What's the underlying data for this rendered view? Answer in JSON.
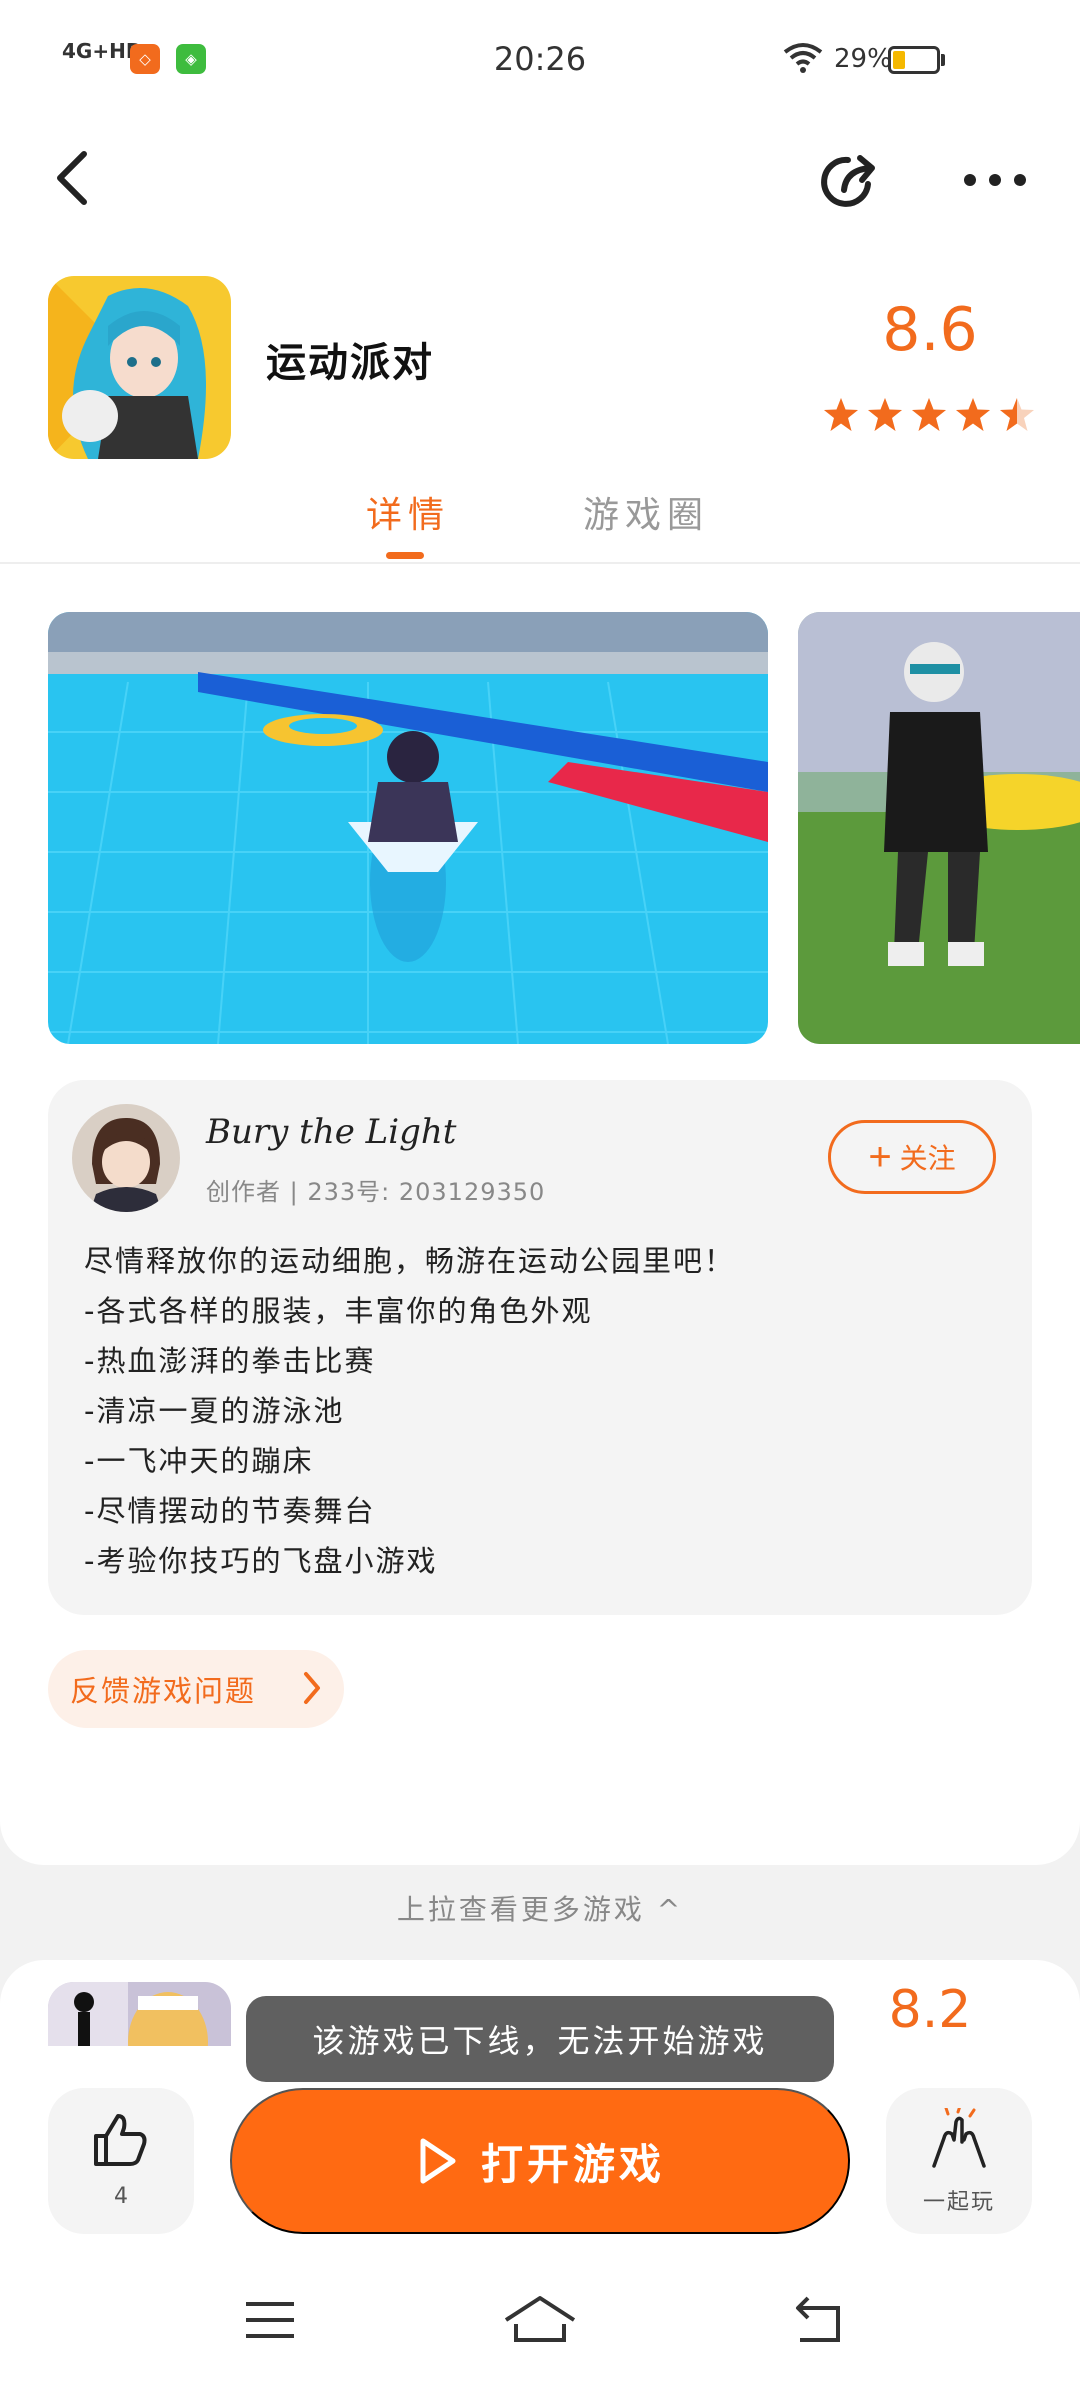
{
  "status_bar": {
    "network": "4G+HD",
    "time": "20:26",
    "battery_text": "29%",
    "battery_level": 0.29,
    "app_icons": [
      {
        "name": "app-icon-orange",
        "color": "#f26b1d"
      },
      {
        "name": "app-icon-green",
        "color": "#3ebc3e"
      }
    ]
  },
  "app": {
    "title": "运动派对",
    "rating": "8.6",
    "stars": 4.5
  },
  "tabs": [
    {
      "label": "详情",
      "active": true
    },
    {
      "label": "游戏圈",
      "active": false
    }
  ],
  "creator": {
    "name": "Bury the Light",
    "meta": "创作者 | 233号: 203129350",
    "follow_label": "关注"
  },
  "description": [
    "尽情释放你的运动细胞，畅游在运动公园里吧！",
    "-各式各样的服装，丰富你的角色外观",
    "-热血澎湃的拳击比赛",
    "-清凉一夏的游泳池",
    "-一飞冲天的蹦床",
    "-尽情摆动的节奏舞台",
    "-考验你技巧的飞盘小游戏"
  ],
  "feedback_label": "反馈游戏问题",
  "pull_more_label": "上拉查看更多游戏 ^",
  "next_game": {
    "rating": "8.2"
  },
  "toast": "该游戏已下线，无法开始游戏",
  "bottom": {
    "like_count": "4",
    "play_label": "打开游戏",
    "together_label": "一起玩"
  },
  "colors": {
    "accent": "#f26b1d",
    "button": "#ff6a12"
  }
}
